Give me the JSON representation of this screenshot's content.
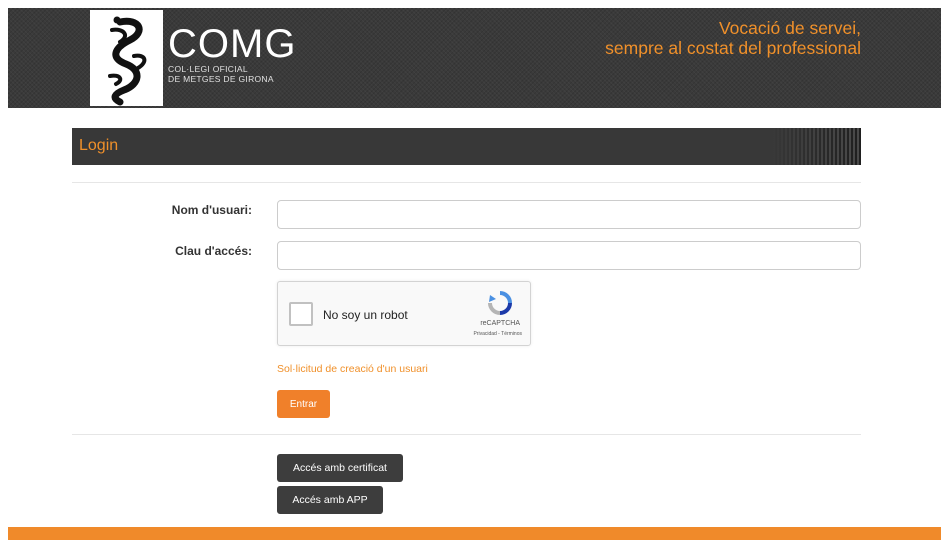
{
  "header": {
    "logo_name": "COMG",
    "logo_sub_line1": "COL·LEGI OFICIAL",
    "logo_sub_line2": "DE METGES DE GIRONA",
    "tagline_line1": "Vocació de servei,",
    "tagline_line2": "sempre al costat del professional"
  },
  "login": {
    "title": "Login",
    "username_label": "Nom d'usuari:",
    "username_value": "",
    "password_label": "Clau d'accés:",
    "password_value": ""
  },
  "captcha": {
    "label": "No soy un robot",
    "brand": "reCAPTCHA",
    "terms": "Privacidad - Términos"
  },
  "links": {
    "create_user": "Sol·licitud de creació d'un usuari"
  },
  "buttons": {
    "submit": "Entrar",
    "certificate": "Accés amb certificat",
    "app": "Accés amb APP"
  },
  "colors": {
    "accent": "#f0902a",
    "header_bg": "#3a3a3a"
  }
}
